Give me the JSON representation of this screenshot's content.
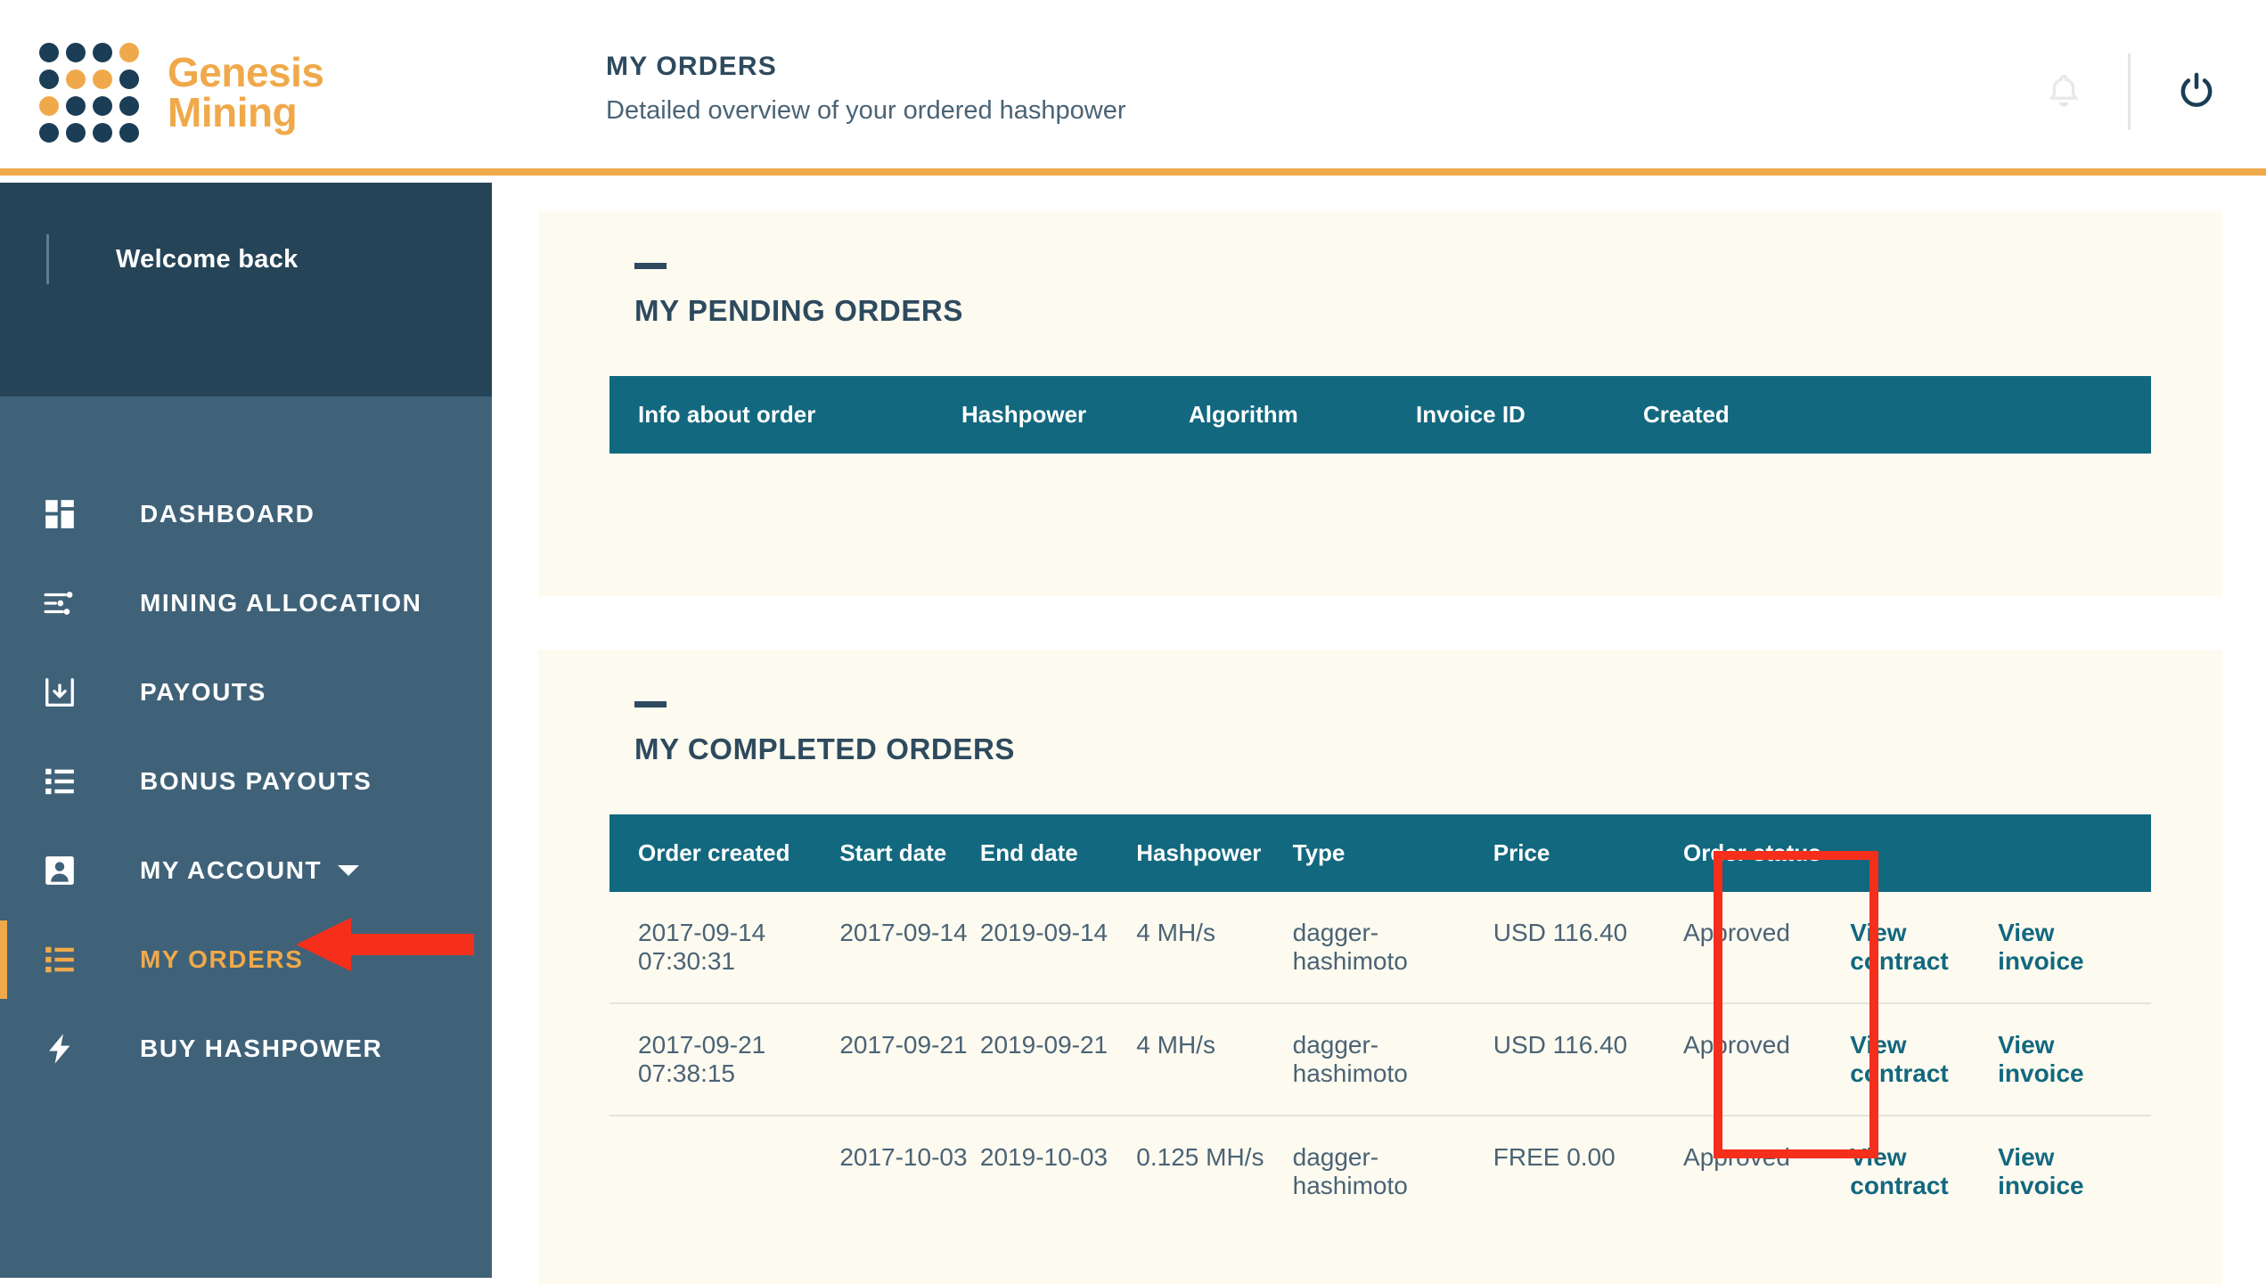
{
  "brand": {
    "name_line1": "Genesis",
    "name_line2": "Mining",
    "accent": "#f0a94a",
    "dark": "#1b3d56",
    "dot_rows": [
      [
        "d",
        "d",
        "d",
        "o"
      ],
      [
        "d",
        "o",
        "o",
        "d"
      ],
      [
        "o",
        "d",
        "d",
        "d"
      ],
      [
        "d",
        "d",
        "d",
        "d"
      ]
    ]
  },
  "header": {
    "title": "MY ORDERS",
    "subtitle": "Detailed overview of your ordered hashpower",
    "bell_icon": "bell-icon",
    "power_icon": "power-icon"
  },
  "sidebar": {
    "welcome": "Welcome back",
    "items": [
      {
        "label": "DASHBOARD",
        "icon": "dashboard-grid-icon",
        "active": false,
        "caret": false
      },
      {
        "label": "MINING ALLOCATION",
        "icon": "sliders-icon",
        "active": false,
        "caret": false
      },
      {
        "label": "PAYOUTS",
        "icon": "download-tray-icon",
        "active": false,
        "caret": false
      },
      {
        "label": "BONUS PAYOUTS",
        "icon": "list-icon",
        "active": false,
        "caret": false
      },
      {
        "label": "MY ACCOUNT",
        "icon": "user-icon",
        "active": false,
        "caret": true
      },
      {
        "label": "MY ORDERS",
        "icon": "list-icon",
        "active": true,
        "caret": false
      },
      {
        "label": "BUY HASHPOWER",
        "icon": "bolt-icon",
        "active": false,
        "caret": false
      }
    ]
  },
  "pending_panel": {
    "title": "MY PENDING ORDERS",
    "columns": [
      "Info about order",
      "Hashpower",
      "Algorithm",
      "Invoice ID",
      "Created"
    ],
    "rows": []
  },
  "completed_panel": {
    "title": "MY COMPLETED ORDERS",
    "columns": [
      "Order created",
      "Start date",
      "End date",
      "Hashpower",
      "Type",
      "Price",
      "Order status",
      "",
      ""
    ],
    "rows": [
      {
        "order_created": "2017-09-14 07:30:31",
        "start_date": "2017-09-14",
        "end_date": "2019-09-14",
        "hashpower": "4 MH/s",
        "type": "dagger-hashimoto",
        "price": "USD 116.40",
        "status": "Approved",
        "contract_link": "View contract",
        "invoice_link": "View invoice"
      },
      {
        "order_created": "2017-09-21 07:38:15",
        "start_date": "2017-09-21",
        "end_date": "2019-09-21",
        "hashpower": "4 MH/s",
        "type": "dagger-hashimoto",
        "price": "USD 116.40",
        "status": "Approved",
        "contract_link": "View contract",
        "invoice_link": "View invoice"
      },
      {
        "order_created": "",
        "start_date": "2017-10-03",
        "end_date": "2019-10-03",
        "hashpower": "0.125 MH/s",
        "type": "dagger-hashimoto",
        "price": "FREE 0.00",
        "status": "Approved",
        "contract_link": "View contract",
        "invoice_link": "View invoice"
      }
    ]
  },
  "annotations": {
    "highlight_color": "#f52f1b",
    "arrow_color": "#f52f1b"
  }
}
